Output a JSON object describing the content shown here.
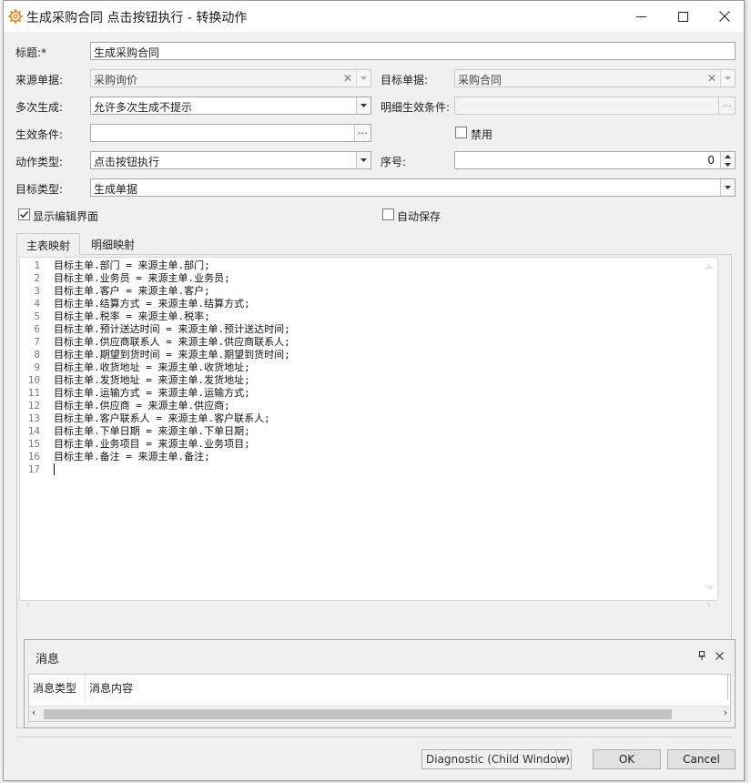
{
  "window": {
    "title": "生成采购合同 点击按钮执行 - 转换动作"
  },
  "form": {
    "title_label": "标题:*",
    "title_value": "生成采购合同",
    "source_label": "来源单据:",
    "source_value": "采购询价",
    "target_doc_label": "目标单据:",
    "target_doc_value": "采购合同",
    "multi_label": "多次生成:",
    "multi_value": "允许多次生成不提示",
    "detail_cond_label": "明细生效条件:",
    "detail_cond_value": "",
    "effect_cond_label": "生效条件:",
    "effect_cond_value": "",
    "disable_label": "禁用",
    "action_type_label": "动作类型:",
    "action_type_value": "点击按钮执行",
    "seq_label": "序号:",
    "seq_value": "0",
    "target_type_label": "目标类型:",
    "target_type_value": "生成单据",
    "show_edit_label": "显示编辑界面",
    "show_edit_checked": true,
    "auto_save_label": "自动保存",
    "auto_save_checked": false,
    "disable_checked": false
  },
  "tabs": [
    {
      "label": "主表映射",
      "active": true
    },
    {
      "label": "明细映射",
      "active": false
    }
  ],
  "editor": {
    "line_numbers": [
      "1",
      "2",
      "3",
      "4",
      "5",
      "6",
      "7",
      "8",
      "9",
      "10",
      "11",
      "12",
      "13",
      "14",
      "15",
      "16",
      "17"
    ],
    "lines": [
      "目标主单.部门 = 来源主单.部门;",
      "目标主单.业务员 = 来源主单.业务员;",
      "目标主单.客户 = 来源主单.客户;",
      "目标主单.结算方式 = 来源主单.结算方式;",
      "目标主单.税率 = 来源主单.税率;",
      "目标主单.预计送达时间 = 来源主单.预计送达时间;",
      "目标主单.供应商联系人 = 来源主单.供应商联系人;",
      "目标主单.期望到货时间 = 来源主单.期望到货时间;",
      "目标主单.收货地址 = 来源主单.收货地址;",
      "目标主单.发货地址 = 来源主单.发货地址;",
      "目标主单.运输方式 = 来源主单.运输方式;",
      "目标主单.供应商 = 来源主单.供应商;",
      "目标主单.客户联系人 = 来源主单.客户联系人;",
      "目标主单.下单日期 = 来源主单.下单日期;",
      "目标主单.业务项目 = 来源主单.业务项目;",
      "目标主单.备注 = 来源主单.备注;",
      ""
    ]
  },
  "messages": {
    "title": "消息",
    "columns": [
      "消息类型",
      "消息内容"
    ]
  },
  "footer": {
    "diagnostic_value": "Diagnostic (Child Window)",
    "ok_label": "OK",
    "cancel_label": "Cancel"
  },
  "colors": {
    "icon_orange": "#e8891c",
    "window_bg": "#f0f0f0"
  }
}
